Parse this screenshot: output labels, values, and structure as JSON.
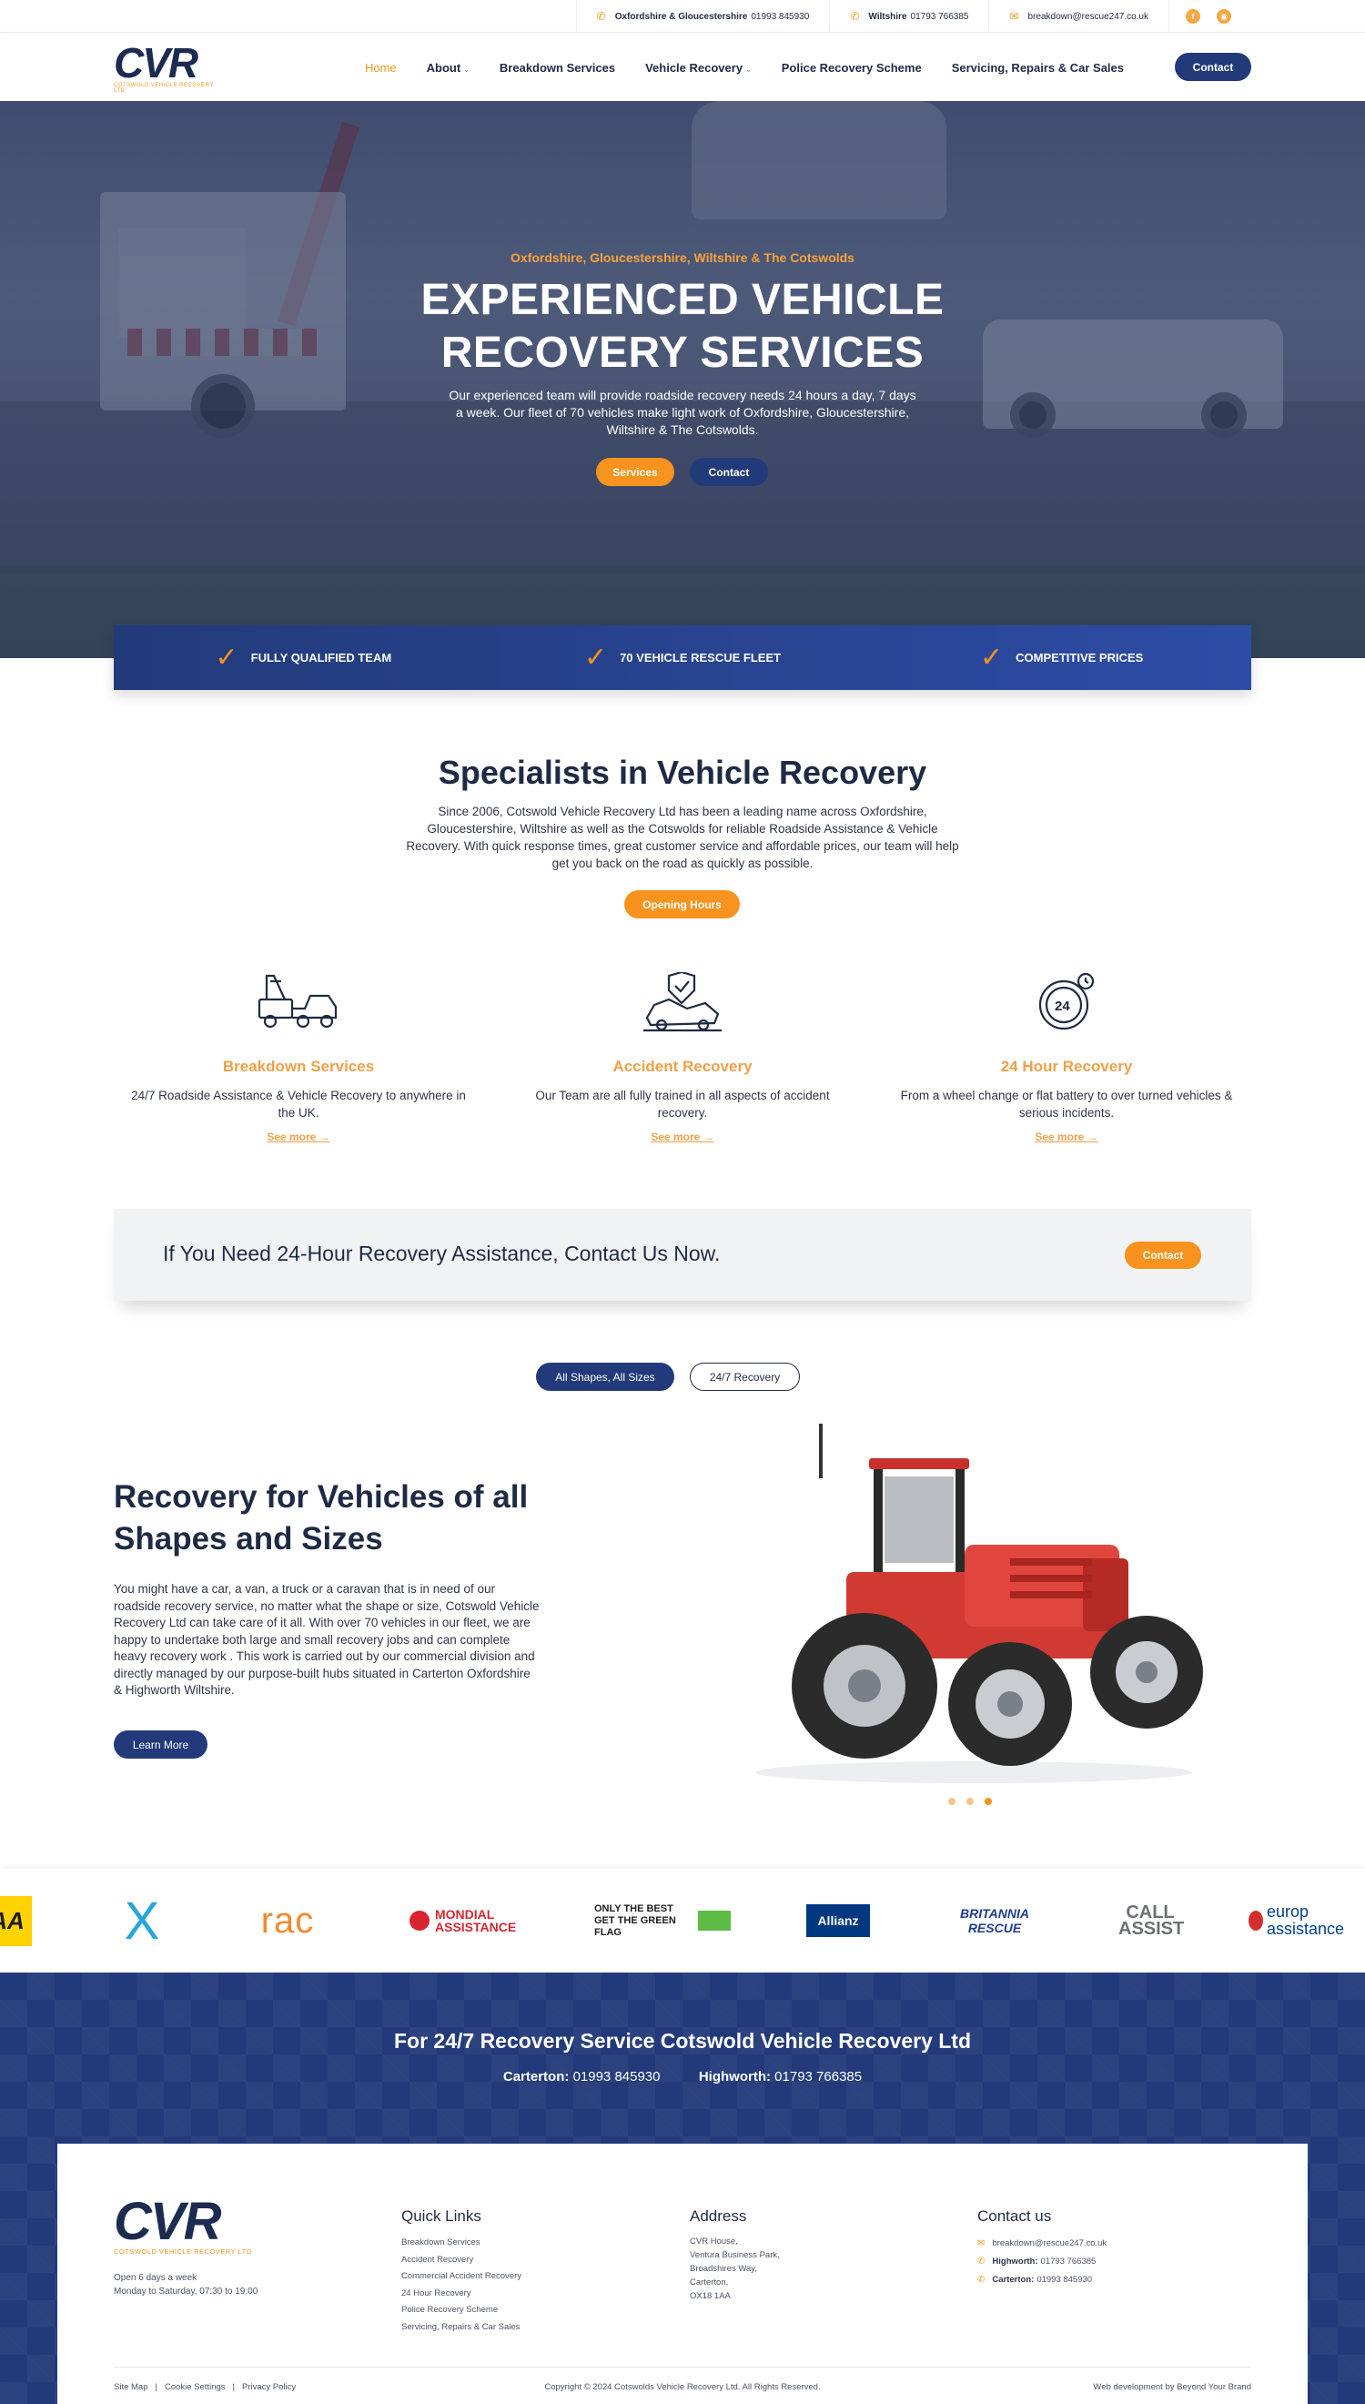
{
  "topbar": {
    "items": [
      {
        "icon": "phone-icon",
        "label": "Oxfordshire & Gloucestershire",
        "value": "01993 845930"
      },
      {
        "icon": "phone-icon",
        "label": "Wiltshire",
        "value": "01793 766385"
      },
      {
        "icon": "mail-icon",
        "label": "",
        "value": "breakdown@rescue247.co.uk"
      }
    ],
    "social": [
      "facebook-icon",
      "rss-icon"
    ]
  },
  "brand": {
    "logo_text": "CVR",
    "logo_sub": "COTSWOLD VEHICLE RECOVERY LTD"
  },
  "nav": {
    "items": [
      {
        "label": "Home",
        "active": true,
        "dropdown": false
      },
      {
        "label": "About",
        "active": false,
        "dropdown": true
      },
      {
        "label": "Breakdown Services",
        "active": false,
        "dropdown": false
      },
      {
        "label": "Vehicle Recovery",
        "active": false,
        "dropdown": true
      },
      {
        "label": "Police Recovery Scheme",
        "active": false,
        "dropdown": false
      },
      {
        "label": "Servicing, Repairs & Car Sales",
        "active": false,
        "dropdown": false
      }
    ],
    "contact_label": "Contact"
  },
  "hero": {
    "kicker": "Oxfordshire,  Gloucestershire, Wiltshire & The Cotswolds",
    "title_line1": "EXPERIENCED VEHICLE",
    "title_line2": "RECOVERY SERVICES",
    "lead": "Our experienced team will provide roadside recovery needs 24 hours a day, 7 days a week. Our fleet of 70 vehicles make light work of Oxfordshire, Gloucestershire, Wiltshire & The Cotswolds.",
    "btn_services": "Services",
    "btn_contact": "Contact"
  },
  "features": [
    "FULLY QUALIFIED TEAM",
    "70 VEHICLE RESCUE FLEET",
    "COMPETITIVE PRICES"
  ],
  "specialists": {
    "title": "Specialists in Vehicle Recovery",
    "body": "Since 2006, Cotswold Vehicle Recovery Ltd has been a leading name across Oxfordshire, Gloucestershire, Wiltshire as well as the Cotswolds for reliable Roadside Assistance & Vehicle Recovery. With quick response times, great customer service and affordable prices, our team will help get you back on the road as quickly as possible.",
    "button": "Opening Hours"
  },
  "services": [
    {
      "icon": "tow-truck-icon",
      "title": "Breakdown Services",
      "text": "24/7 Roadside Assistance & Vehicle Recovery to anywhere in the UK.",
      "more": "See more →"
    },
    {
      "icon": "car-accident-icon",
      "title": "Accident Recovery",
      "text": "Our Team are all fully trained in all aspects of accident recovery.",
      "more": "See more →"
    },
    {
      "icon": "24-hour-icon",
      "title": "24 Hour Recovery",
      "text": "From a wheel change or flat battery to over turned vehicles & serious incidents.",
      "more": "See more →"
    }
  ],
  "cta": {
    "text": "If You Need 24-Hour Recovery Assistance, Contact Us Now.",
    "button": "Contact"
  },
  "tabs": [
    "All Shapes, All Sizes",
    "24/7 Recovery"
  ],
  "recovery": {
    "title": "Recovery for Vehicles of all Shapes and Sizes",
    "body": "You might have a car, a van, a truck or a caravan that is in need of our roadside recovery service, no matter what the shape or size, Cotswold Vehicle Recovery Ltd can take care of it all. With over 70 vehicles in our fleet, we are happy to undertake both large and small recovery jobs and can complete heavy recovery work . This work is carried out by our commercial division and directly managed by our purpose-built hubs situated in Carterton Oxfordshire & Highworth Wiltshire.",
    "button": "Learn More",
    "slide_count": 3,
    "active_slide": 3
  },
  "partners": [
    "AA",
    "X",
    "RAC",
    "MONDIAL ASSISTANCE",
    "ONLY THE BEST GET THE GREEN FLAG",
    "Allianz",
    "BRITANNIA RESCUE",
    "CALL ASSIST",
    "europ assistance"
  ],
  "colors": {
    "navy": "#223a7a",
    "orange": "#f7931e",
    "text": "#1f2a44"
  },
  "band": {
    "title": "For 24/7 Recovery Service Cotswold Vehicle Recovery Ltd",
    "phone1_label": "Carterton:",
    "phone1": "01993 845930",
    "phone2_label": "Highworth:",
    "phone2": "01793 766385"
  },
  "footer": {
    "logo_text": "CVR",
    "logo_sub": "COTSWOLD VEHICLE RECOVERY LTD",
    "open_line1": "Open 6 days a week",
    "open_line2": "Monday to Saturday, 07:30 to 19:00",
    "quick_links_title": "Quick Links",
    "quick_links": [
      "Breakdown Services",
      "Accident Recovery",
      "Commercial Accident Recovery",
      "24 Hour Recovery",
      "Police Recovery Scheme",
      "Servicing, Repairs & Car Sales"
    ],
    "address_title": "Address",
    "address": [
      "CVR House,",
      "Ventura Business Park,",
      "Broadshires Way,",
      "Carterton,",
      "OX18 1AA"
    ],
    "contact_title": "Contact us",
    "contact": [
      {
        "icon": "mail-icon",
        "label": "",
        "value": "breakdown@rescue247.co.uk"
      },
      {
        "icon": "phone-icon",
        "label": "Highworth:",
        "value": "01793 766385"
      },
      {
        "icon": "phone-icon",
        "label": "Carterton:",
        "value": "01993 845930"
      }
    ],
    "bottom_links": [
      "Site Map",
      "Cookie Settings",
      "Privacy Policy"
    ],
    "copyright": "Copyright © 2024 Cotswolds Vehicle Recovery Ltd. All Rights Reserved.",
    "credit": "Web development by Beyond Your Brand"
  }
}
